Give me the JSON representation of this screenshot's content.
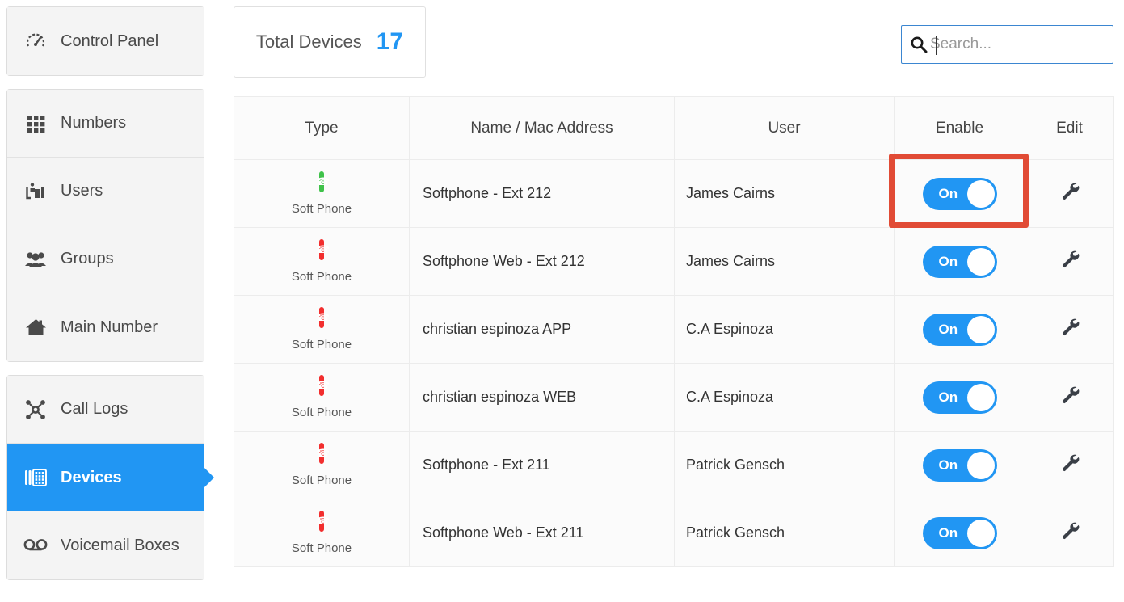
{
  "sidebar": {
    "groups": [
      {
        "items": [
          {
            "label": "Control Panel",
            "icon": "gauge-icon",
            "active": false
          }
        ]
      },
      {
        "items": [
          {
            "label": "Numbers",
            "icon": "grid-dots-icon",
            "active": false
          },
          {
            "label": "Users",
            "icon": "user-desk-icon",
            "active": false
          },
          {
            "label": "Groups",
            "icon": "people-group-icon",
            "active": false
          },
          {
            "label": "Main Number",
            "icon": "home-icon",
            "active": false
          }
        ]
      },
      {
        "items": [
          {
            "label": "Call Logs",
            "icon": "network-nodes-icon",
            "active": false
          },
          {
            "label": "Devices",
            "icon": "desk-phone-icon",
            "active": true
          },
          {
            "label": "Voicemail Boxes",
            "icon": "voicemail-icon",
            "active": false
          }
        ]
      }
    ]
  },
  "header": {
    "total_card": {
      "label": "Total Devices",
      "value": "17"
    },
    "search": {
      "placeholder": "Search...",
      "value": "",
      "icon": "search-icon"
    }
  },
  "table": {
    "columns": [
      "Type",
      "Name / Mac Address",
      "User",
      "Enable",
      "Edit"
    ],
    "rows": [
      {
        "type_label": "Soft Phone",
        "type_icon": "softphone-monitor-icon",
        "type_color": "#3fc24a",
        "name": "Softphone - Ext 212",
        "user": "James Cairns",
        "enable": "On",
        "edit_icon": "wrench-icon",
        "highlighted": true
      },
      {
        "type_label": "Soft Phone",
        "type_icon": "softphone-monitor-icon",
        "type_color": "#f22e2e",
        "name": "Softphone Web - Ext 212",
        "user": "James Cairns",
        "enable": "On",
        "edit_icon": "wrench-icon",
        "highlighted": false
      },
      {
        "type_label": "Soft Phone",
        "type_icon": "softphone-monitor-icon",
        "type_color": "#f22e2e",
        "name": "christian espinoza APP",
        "user": "C.A Espinoza",
        "enable": "On",
        "edit_icon": "wrench-icon",
        "highlighted": false
      },
      {
        "type_label": "Soft Phone",
        "type_icon": "softphone-monitor-icon",
        "type_color": "#f22e2e",
        "name": "christian espinoza WEB",
        "user": "C.A Espinoza",
        "enable": "On",
        "edit_icon": "wrench-icon",
        "highlighted": false
      },
      {
        "type_label": "Soft Phone",
        "type_icon": "softphone-monitor-icon",
        "type_color": "#f22e2e",
        "name": "Softphone - Ext 211",
        "user": "Patrick Gensch",
        "enable": "On",
        "edit_icon": "wrench-icon",
        "highlighted": false
      },
      {
        "type_label": "Soft Phone",
        "type_icon": "softphone-monitor-icon",
        "type_color": "#f22e2e",
        "name": "Softphone Web - Ext 211",
        "user": "Patrick Gensch",
        "enable": "On",
        "edit_icon": "wrench-icon",
        "highlighted": false
      }
    ]
  },
  "colors": {
    "accent_blue": "#2196f3",
    "highlight_red": "#e14b35",
    "icon_green": "#3fc24a",
    "icon_red": "#f22e2e"
  }
}
